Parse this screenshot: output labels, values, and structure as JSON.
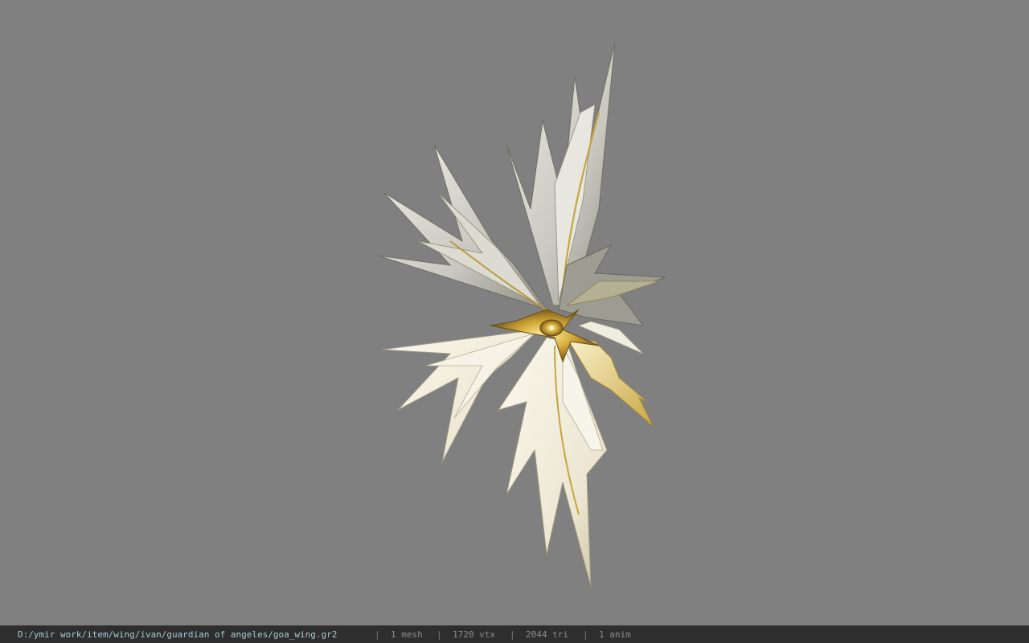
{
  "viewport": {
    "background_color": "#808080",
    "model_name": "goa_wing"
  },
  "statusbar": {
    "path": "D:/ymir work/item/wing/ivan/guardian of angeles/goa_wing.gr2",
    "separator": "|",
    "mesh": "1 mesh",
    "vertices": "1720 vtx",
    "triangles": "2044 tri",
    "animations": "1 anim",
    "path_color": "#a9c9d6",
    "text_color": "#8d8d8d"
  }
}
